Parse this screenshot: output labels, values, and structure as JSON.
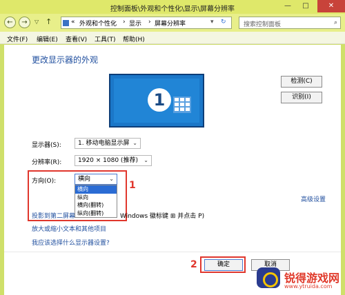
{
  "window": {
    "title": "控制面板\\外观和个性化\\显示\\屏幕分辨率",
    "minimize": "—",
    "maximize": "□",
    "close": "✕"
  },
  "nav": {
    "back": "←",
    "forward": "→",
    "recent": "▽",
    "up": "↑",
    "breadcrumb": [
      "«",
      "外观和个性化",
      "›",
      "显示",
      "›",
      "屏幕分辨率"
    ],
    "refresh": "↻",
    "search_placeholder": "搜索控制面板",
    "search_icon": "⌕"
  },
  "menu": [
    "文件(F)",
    "编辑(E)",
    "查看(V)",
    "工具(T)",
    "帮助(H)"
  ],
  "page": {
    "heading": "更改显示器的外观",
    "monitor_number": "1",
    "detect_button": "检测(C)",
    "identify_button": "识别(I)",
    "display_label": "显示器(S):",
    "display_value": "1. 移动电脑显示屏",
    "resolution_label": "分辨率(R):",
    "resolution_value": "1920 × 1080 (推荐)",
    "orientation_label": "方向(O):",
    "orientation_value": "横向",
    "orientation_options": [
      "横向",
      "纵向",
      "横向(翻转)",
      "纵向(翻转)"
    ],
    "advanced_link": "高级设置",
    "project_link": "投影到第二屏幕",
    "project_tail": "Windows 徽标键 ⊞ 并点击 P)",
    "text_size_link": "放大或缩小文本和其他项目",
    "which_settings_link": "我应该选择什么显示器设置?",
    "ok_button": "确定",
    "cancel_button": "取消"
  },
  "annotations": {
    "step1": "1",
    "step2": "2"
  },
  "watermark": {
    "title": "锐得游戏网",
    "url": "www.ytruida.com"
  }
}
